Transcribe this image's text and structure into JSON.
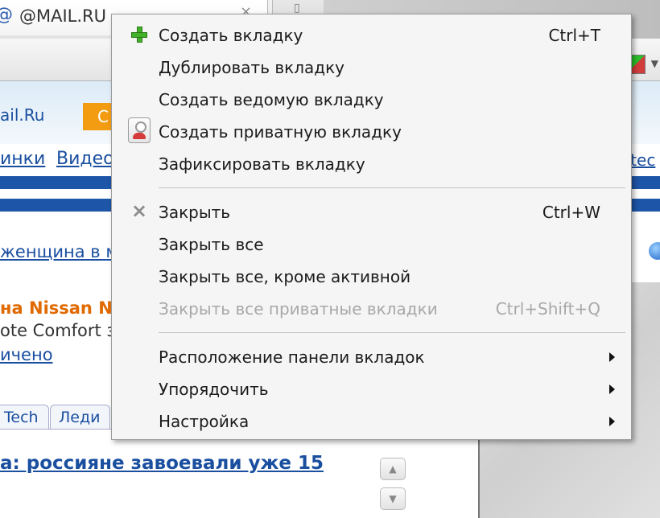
{
  "browser": {
    "tab_title": "@MAIL.RU",
    "tab_icon": "@",
    "close_glyph": "×"
  },
  "page": {
    "site_logo": "ail.Ru",
    "search_button": "С",
    "nav_links": [
      "инки",
      "Видео"
    ],
    "side_link": "-tec",
    "news": [
      "женщина в м",
      "на Nissan No",
      "ote Comfort з",
      "ичено"
    ],
    "subtabs": [
      "Tech",
      "Леди"
    ],
    "headline": "а: россияне завоевали уже 15"
  },
  "menu": {
    "groups": [
      [
        {
          "label": "Создать вкладку",
          "shortcut": "Ctrl+T",
          "icon": "plus-icon",
          "enabled": true
        },
        {
          "label": "Дублировать вкладку",
          "shortcut": "",
          "icon": "",
          "enabled": true
        },
        {
          "label": "Создать ведомую вкладку",
          "shortcut": "",
          "icon": "",
          "enabled": true
        },
        {
          "label": "Создать приватную вкладку",
          "shortcut": "",
          "icon": "private-tab-icon",
          "enabled": true
        },
        {
          "label": "Зафиксировать вкладку",
          "shortcut": "",
          "icon": "",
          "enabled": true
        }
      ],
      [
        {
          "label": "Закрыть",
          "shortcut": "Ctrl+W",
          "icon": "close-icon",
          "enabled": true
        },
        {
          "label": "Закрыть все",
          "shortcut": "",
          "icon": "",
          "enabled": true
        },
        {
          "label": "Закрыть все, кроме активной",
          "shortcut": "",
          "icon": "",
          "enabled": true
        },
        {
          "label": "Закрыть все приватные вкладки",
          "shortcut": "Ctrl+Shift+Q",
          "icon": "",
          "enabled": false
        }
      ],
      [
        {
          "label": "Расположение панели вкладок",
          "shortcut": "",
          "icon": "",
          "enabled": true,
          "submenu": true
        },
        {
          "label": "Упорядочить",
          "shortcut": "",
          "icon": "",
          "enabled": true,
          "submenu": true
        },
        {
          "label": "Настройка",
          "shortcut": "",
          "icon": "",
          "enabled": true,
          "submenu": true
        }
      ]
    ]
  }
}
